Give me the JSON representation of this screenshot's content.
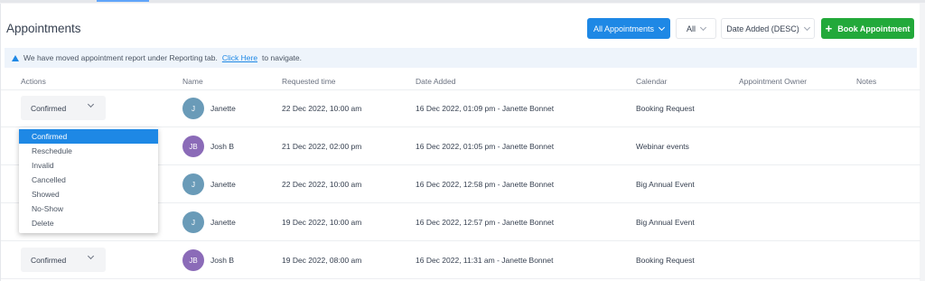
{
  "header": {
    "title": "Appointments",
    "filters": {
      "appointments": "All Appointments",
      "status": "All",
      "sort": "Date Added (DESC)"
    },
    "book_button": "Book Appointment",
    "book_icon": "+"
  },
  "notice": {
    "text_before": "We have moved appointment report under Reporting tab.",
    "link": "Click Here",
    "text_after": "to navigate."
  },
  "table": {
    "columns": [
      "Actions",
      "Name",
      "Requested time",
      "Date Added",
      "Calendar",
      "Appointment Owner",
      "Notes"
    ],
    "rows": [
      {
        "status": "Confirmed",
        "initials": "J",
        "avatar_color": "#6a9bb8",
        "name": "Janette",
        "requested": "22 Dec 2022, 10:00 am",
        "added": "16 Dec 2022, 01:09 pm - Janette Bonnet",
        "calendar": "Booking Request"
      },
      {
        "status": "",
        "initials": "JB",
        "avatar_color": "#8b6bb8",
        "name": "Josh B",
        "requested": "21 Dec 2022, 02:00 pm",
        "added": "16 Dec 2022, 01:05 pm - Janette Bonnet",
        "calendar": "Webinar events"
      },
      {
        "status": "",
        "initials": "J",
        "avatar_color": "#6a9bb8",
        "name": "Janette",
        "requested": "22 Dec 2022, 10:00 am",
        "added": "16 Dec 2022, 12:58 pm - Janette Bonnet",
        "calendar": "Big Annual Event"
      },
      {
        "status": "",
        "initials": "J",
        "avatar_color": "#6a9bb8",
        "name": "Janette",
        "requested": "19 Dec 2022, 10:00 am",
        "added": "16 Dec 2022, 12:57 pm - Janette Bonnet",
        "calendar": "Big Annual Event"
      },
      {
        "status": "Confirmed",
        "initials": "JB",
        "avatar_color": "#8b6bb8",
        "name": "Josh B",
        "requested": "19 Dec 2022, 08:00 am",
        "added": "16 Dec 2022, 11:31 am - Janette Bonnet",
        "calendar": "Booking Request"
      }
    ]
  },
  "status_dropdown": {
    "options": [
      "Confirmed",
      "Reschedule",
      "Invalid",
      "Cancelled",
      "Showed",
      "No-Show",
      "Delete"
    ],
    "selected_index": 0
  },
  "colors": {
    "primary": "#1e88e5",
    "success": "#22a93a"
  }
}
